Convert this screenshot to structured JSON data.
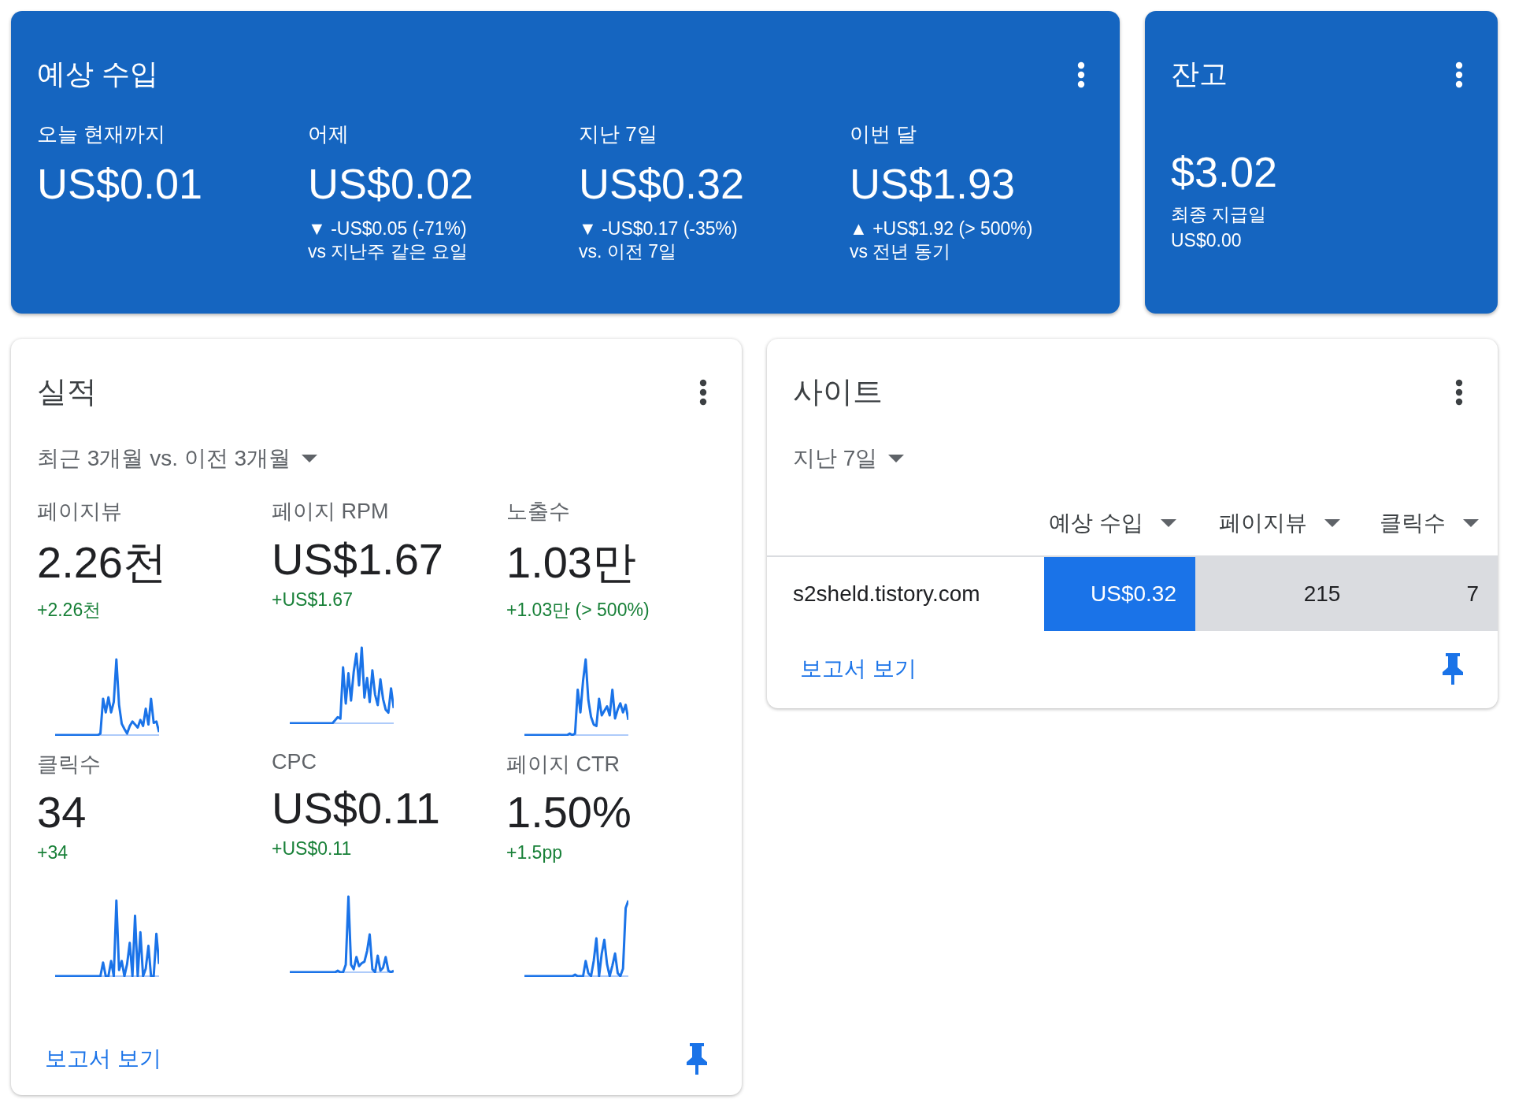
{
  "earnings": {
    "title": "예상 수입",
    "metrics": [
      {
        "label": "오늘 현재까지",
        "value": "US$0.01"
      },
      {
        "label": "어제",
        "value": "US$0.02",
        "change": "▼ -US$0.05 (-71%)",
        "comparison": "vs 지난주 같은 요일"
      },
      {
        "label": "지난 7일",
        "value": "US$0.32",
        "change": "▼ -US$0.17 (-35%)",
        "comparison": "vs. 이전 7일"
      },
      {
        "label": "이번 달",
        "value": "US$1.93",
        "change": "▲ +US$1.92 (> 500%)",
        "comparison": "vs 전년 동기"
      }
    ]
  },
  "balance": {
    "title": "잔고",
    "amount": "$3.02",
    "last_payment_label": "최종 지급일",
    "last_payment": "US$0.00"
  },
  "performance": {
    "title": "실적",
    "range": "최근 3개월 vs. 이전 3개월",
    "metrics": [
      {
        "label": "페이지뷰",
        "value": "2.26천",
        "change": "+2.26천"
      },
      {
        "label": "페이지 RPM",
        "value": "US$1.67",
        "change": "+US$1.67"
      },
      {
        "label": "노출수",
        "value": "1.03만",
        "change": "+1.03만 (> 500%)"
      },
      {
        "label": "클릭수",
        "value": "34",
        "change": "+34"
      },
      {
        "label": "CPC",
        "value": "US$0.11",
        "change": "+US$0.11"
      },
      {
        "label": "페이지 CTR",
        "value": "1.50%",
        "change": "+1.5pp"
      }
    ],
    "link": "보고서 보기"
  },
  "sites": {
    "title": "사이트",
    "range": "지난 7일",
    "columns": [
      {
        "label": "예상 수입",
        "selected": true
      },
      {
        "label": "페이지뷰",
        "selected": false
      },
      {
        "label": "클릭수",
        "selected": false
      }
    ],
    "rows": [
      {
        "site": "s2sheld.tistory.com",
        "cells": [
          "US$0.32",
          "215",
          "7"
        ]
      }
    ],
    "link": "보고서 보기"
  }
}
